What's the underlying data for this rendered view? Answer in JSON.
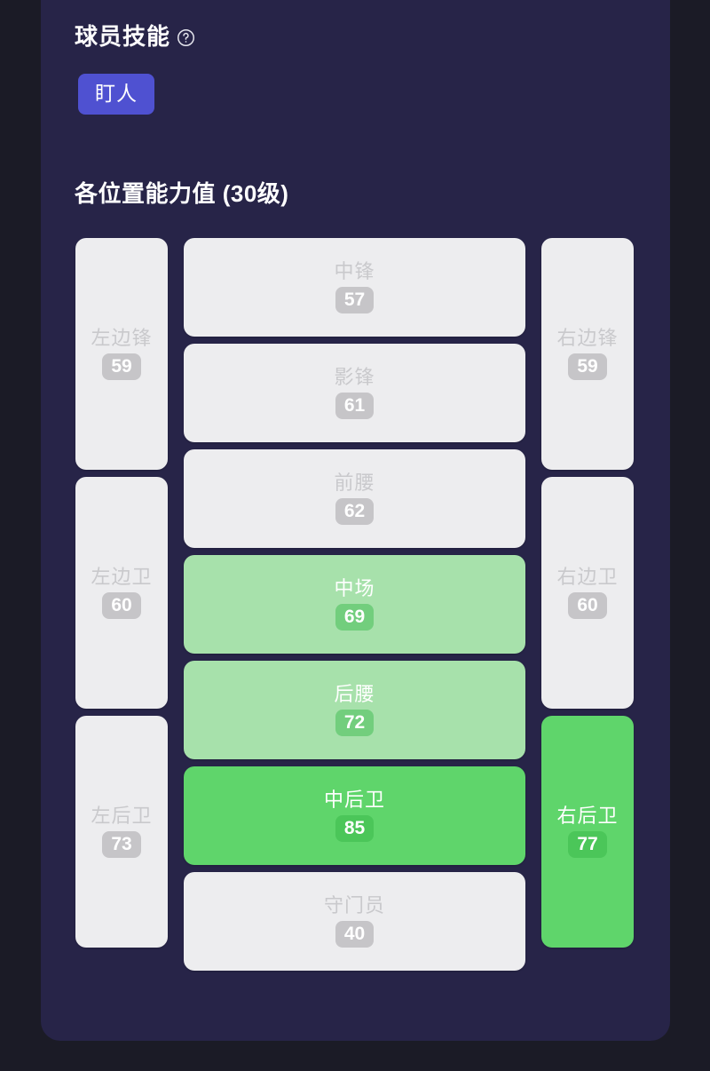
{
  "theme": {
    "page_background": "#1b1b26",
    "panel_background": "#272448",
    "skill_pill_color": "#4f51d1",
    "tier_none_color": "#ededef",
    "tier_mid_color": "#a7e1ab",
    "tier_best_color": "#5fd56b",
    "title_color": "#ffffff"
  },
  "header": {
    "title": "球员技能",
    "help_icon": "question-mark-circle-icon"
  },
  "skills": [
    {
      "label": "盯人"
    }
  ],
  "positions_section": {
    "title": "各位置能力值 (30级)"
  },
  "pitch": {
    "left_column": [
      {
        "label": "左边锋",
        "value": "59",
        "tier": "none"
      },
      {
        "label": "左边卫",
        "value": "60",
        "tier": "none"
      },
      {
        "label": "左后卫",
        "value": "73",
        "tier": "none"
      }
    ],
    "center_column": [
      {
        "label": "中锋",
        "value": "57",
        "tier": "none"
      },
      {
        "label": "影锋",
        "value": "61",
        "tier": "none"
      },
      {
        "label": "前腰",
        "value": "62",
        "tier": "none"
      },
      {
        "label": "中场",
        "value": "69",
        "tier": "mid"
      },
      {
        "label": "后腰",
        "value": "72",
        "tier": "mid"
      },
      {
        "label": "中后卫",
        "value": "85",
        "tier": "best"
      },
      {
        "label": "守门员",
        "value": "40",
        "tier": "none"
      }
    ],
    "right_column": [
      {
        "label": "右边锋",
        "value": "59",
        "tier": "none"
      },
      {
        "label": "右边卫",
        "value": "60",
        "tier": "none"
      },
      {
        "label": "右后卫",
        "value": "77",
        "tier": "best"
      }
    ]
  }
}
